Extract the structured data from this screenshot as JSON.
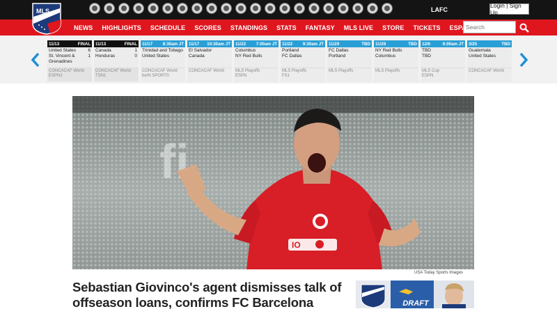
{
  "header": {
    "logo_text": "MLS",
    "clubs": [
      "club-crest-1",
      "club-crest-2",
      "club-crest-3",
      "club-crest-4",
      "club-crest-5",
      "club-crest-6",
      "club-crest-7",
      "club-crest-8",
      "club-crest-9",
      "club-crest-10",
      "club-crest-11",
      "club-crest-12",
      "club-crest-13",
      "club-crest-14",
      "club-crest-15",
      "club-crest-16",
      "club-crest-17",
      "club-crest-18",
      "club-crest-19",
      "club-crest-20",
      "club-crest-21"
    ],
    "club_label": "LAFC",
    "login_label": "Login | Sign Up"
  },
  "nav": {
    "items": [
      "NEWS",
      "HIGHLIGHTS",
      "SCHEDULE",
      "SCORES",
      "STANDINGS",
      "STATS",
      "FANTASY",
      "MLS LIVE",
      "STORE",
      "TICKETS",
      "ESPAÑOL"
    ],
    "search_placeholder": "Search"
  },
  "matches": [
    {
      "date": "11/13",
      "status": "FINAL",
      "final": true,
      "home": "United States",
      "away": "St. Vincent & Grenadines",
      "home_score": "6",
      "away_score": "1",
      "comp": "CONCACAF World",
      "tv": "ESPN2"
    },
    {
      "date": "11/13",
      "status": "FINAL",
      "final": true,
      "home": "Canada",
      "away": "Honduras",
      "home_score": "1",
      "away_score": "0",
      "comp": "CONCACAF World",
      "tv": "TSN1"
    },
    {
      "date": "11/17",
      "status": "8:30am JT",
      "final": false,
      "home": "Trinidad and Tobago",
      "away": "United States",
      "home_score": "",
      "away_score": "",
      "comp": "CONCACAF World",
      "tv": "beIN SPORTS"
    },
    {
      "date": "11/17",
      "status": "10:30am JT",
      "final": false,
      "home": "El Salvador",
      "away": "Canada",
      "home_score": "",
      "away_score": "",
      "comp": "CONCACAF World",
      "tv": ""
    },
    {
      "date": "11/22",
      "status": "7:00am JT",
      "final": false,
      "home": "Columbus",
      "away": "NY Red Bulls",
      "home_score": "",
      "away_score": "",
      "comp": "MLS Playoffs",
      "tv": "ESPN"
    },
    {
      "date": "11/22",
      "status": "9:30am JT",
      "final": false,
      "home": "Portland",
      "away": "FC Dallas",
      "home_score": "",
      "away_score": "",
      "comp": "MLS Playoffs",
      "tv": "FS1"
    },
    {
      "date": "11/29",
      "status": "TBD",
      "final": false,
      "home": "FC Dallas",
      "away": "Portland",
      "home_score": "",
      "away_score": "",
      "comp": "MLS Playoffs",
      "tv": ""
    },
    {
      "date": "11/29",
      "status": "TBD",
      "final": false,
      "home": "NY Red Bulls",
      "away": "Columbus",
      "home_score": "",
      "away_score": "",
      "comp": "MLS Playoffs",
      "tv": ""
    },
    {
      "date": "12/6",
      "status": "6:00am JT",
      "final": false,
      "home": "TBD",
      "away": "TBD",
      "home_score": "",
      "away_score": "",
      "comp": "MLS Cup",
      "tv": "ESPN"
    },
    {
      "date": "3/25",
      "status": "TBD",
      "final": false,
      "home": "Guatemala",
      "away": "United States",
      "home_score": "",
      "away_score": "",
      "comp": "CONCACAF World",
      "tv": ""
    }
  ],
  "article": {
    "photo_credit": "USA Today Sports Images",
    "headline": "Sebastian Giovinco's agent dismisses talk of offseason loans, confirms FC Barcelona"
  },
  "ad": {
    "brand": "DRAFT KINGS"
  },
  "colors": {
    "nav_red": "#e0161f",
    "top_black": "#141414",
    "accent_blue": "#2a9fd6",
    "logo_navy": "#1d3a7a"
  }
}
